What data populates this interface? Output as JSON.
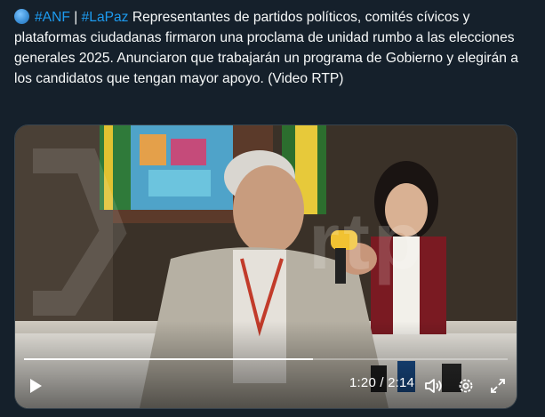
{
  "tweet": {
    "hashtag_1": "#ANF",
    "separator": " | ",
    "hashtag_2": "#LaPaz",
    "body": " Representantes de partidos políticos, comités cívicos y plataformas ciudadanas firmaron una proclama de unidad rumbo a las elecciones generales 2025. Anunciaron que trabajarán un programa de Gobierno y elegirán a los candidatos que tengan mayor apoyo. (Video RTP)"
  },
  "video": {
    "time_display": "1:20 / 2:14",
    "progress": 0.597,
    "watermark": "rtp",
    "icons": {
      "play": "play-icon",
      "volume": "volume-icon",
      "settings": "gear-icon",
      "fullscreen": "fullscreen-icon"
    }
  },
  "colors": {
    "background": "#15202b",
    "text": "#f7f9f9",
    "hashtag": "#1d9bf0",
    "border": "#38444d"
  }
}
